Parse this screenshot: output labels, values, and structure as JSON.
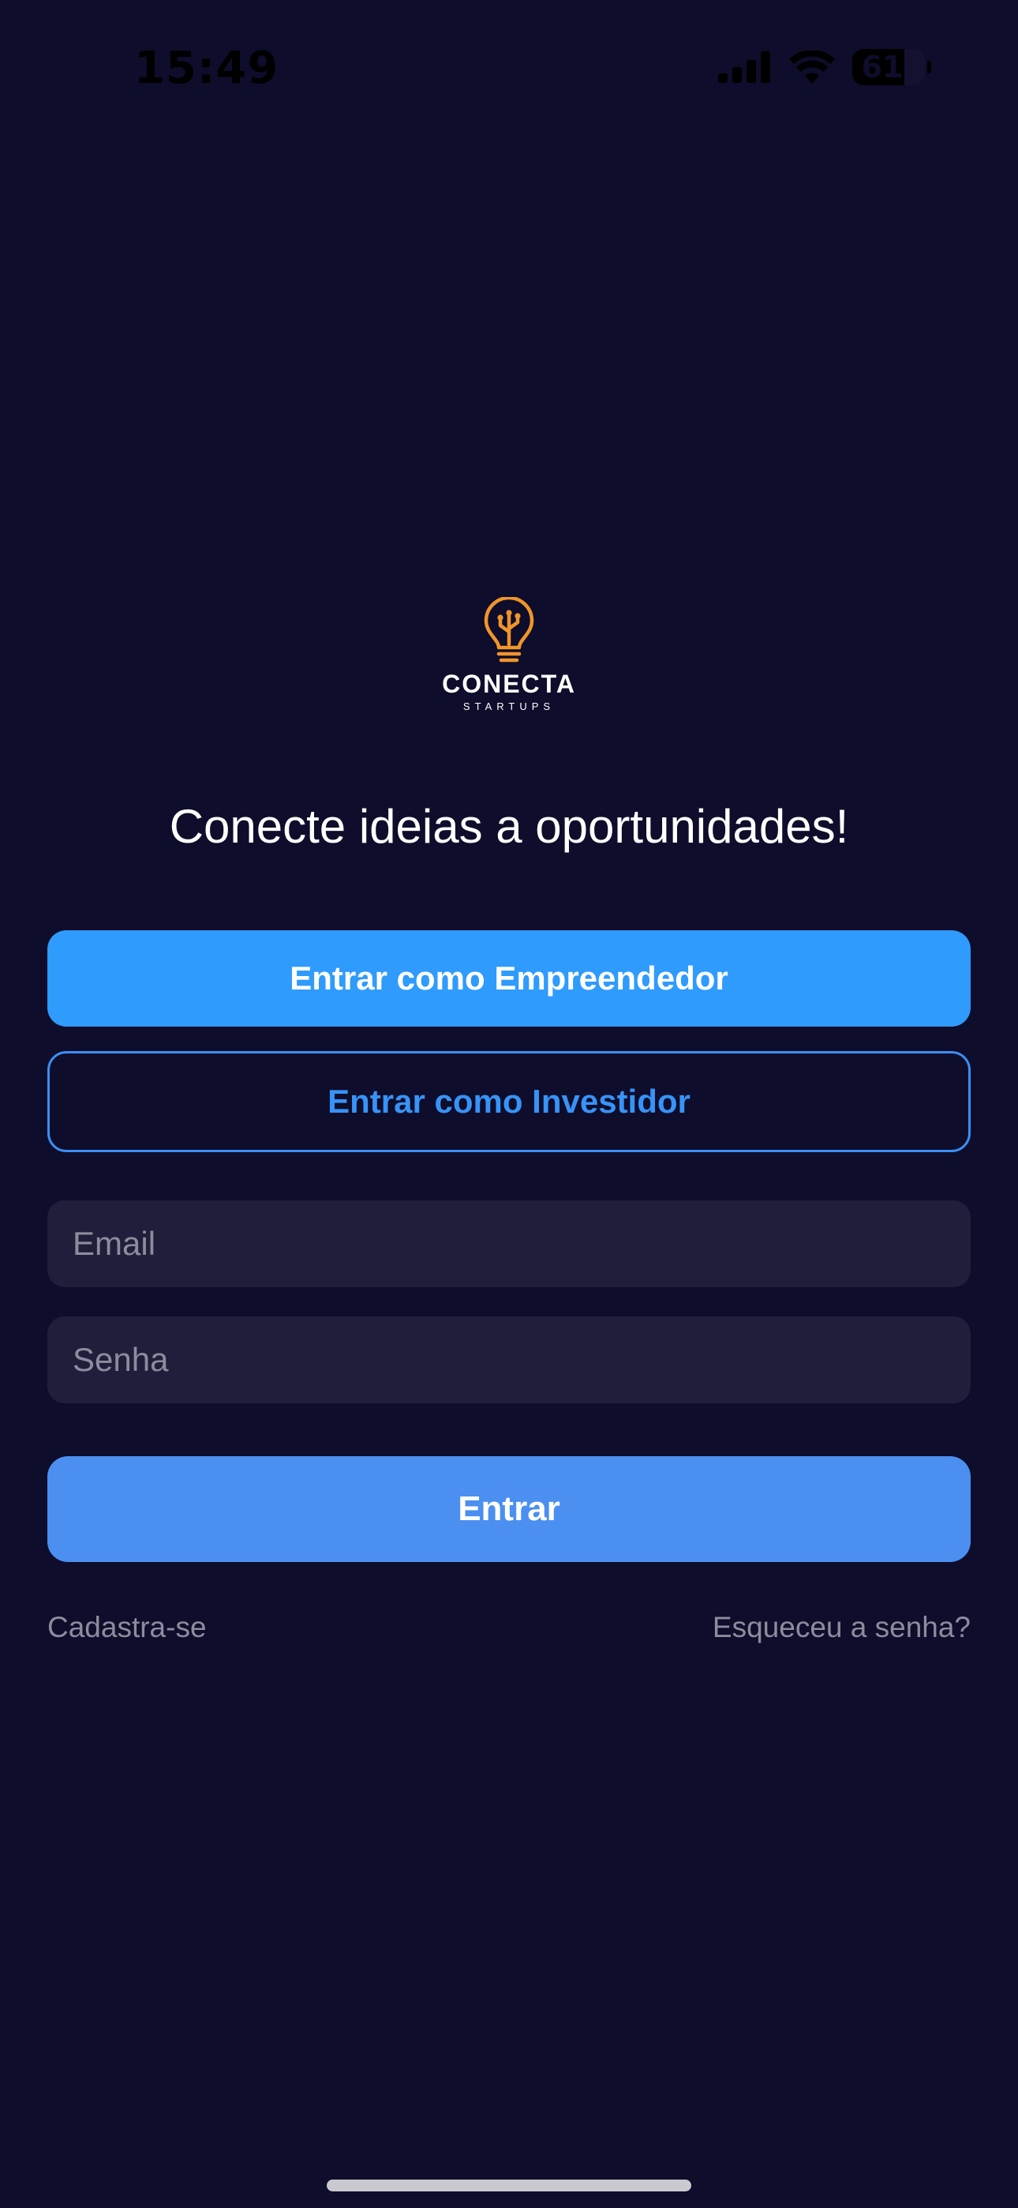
{
  "status_bar": {
    "time": "15:49",
    "battery": "61",
    "icons": [
      "cellular-signal-icon",
      "wifi-icon",
      "battery-icon"
    ]
  },
  "logo": {
    "icon": "lightbulb-circuit-icon",
    "wordmark": "CONECTA",
    "subtitle": "STARTUPS",
    "color": "#f0952a"
  },
  "headline": "Conecte ideias a oportunidades!",
  "buttons": {
    "entrepreneur": "Entrar como Empreendedor",
    "investor": "Entrar como Investidor",
    "login": "Entrar"
  },
  "form": {
    "email_placeholder": "Email",
    "email_value": "",
    "password_placeholder": "Senha",
    "password_value": ""
  },
  "links": {
    "signup": "Cadastra-se",
    "forgot_password": "Esqueceu a senha?"
  },
  "colors": {
    "background": "#0e0d2b",
    "primary": "#2f9bfd",
    "login_button": "#4b8ff0",
    "input_background": "#1f1f3b",
    "muted_text": "#8d8c9e"
  }
}
